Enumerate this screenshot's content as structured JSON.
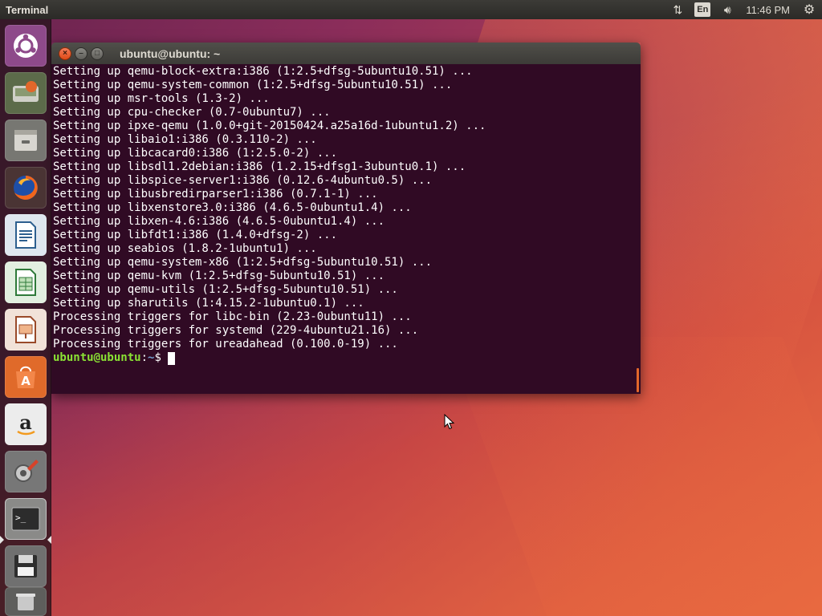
{
  "top_panel": {
    "app_title": "Terminal",
    "network_icon": "network-updown-icon",
    "language": "En",
    "volume_icon": "volume-icon",
    "clock": "11:46 PM",
    "settings_icon": "gear-icon"
  },
  "launcher": {
    "items": [
      {
        "name": "ubuntu-dash-icon",
        "bg": "#7a3a7a"
      },
      {
        "name": "install-ubuntu-icon",
        "bg": "#5a6b48"
      },
      {
        "name": "files-icon",
        "bg": "#6a6a66"
      },
      {
        "name": "firefox-icon",
        "bg": "#5b3a3a"
      },
      {
        "name": "libreoffice-writer-icon",
        "bg": "#2d5f8f"
      },
      {
        "name": "libreoffice-calc-icon",
        "bg": "#2f7a3a"
      },
      {
        "name": "libreoffice-impress-icon",
        "bg": "#9a4a2a"
      },
      {
        "name": "ubuntu-software-icon",
        "bg": "#c8561e"
      },
      {
        "name": "amazon-icon",
        "bg": "#e9e9e9"
      },
      {
        "name": "system-settings-icon",
        "bg": "#6e6e6e"
      },
      {
        "name": "terminal-icon",
        "bg": "#3a3a3a"
      },
      {
        "name": "save-disk-icon",
        "bg": "#6a6a66"
      },
      {
        "name": "trash-icon",
        "bg": "#5a5a58"
      }
    ]
  },
  "terminal": {
    "title": "ubuntu@ubuntu: ~",
    "close_glyph": "×",
    "min_glyph": "–",
    "max_glyph": "□",
    "lines": [
      "Setting up qemu-block-extra:i386 (1:2.5+dfsg-5ubuntu10.51) ...",
      "Setting up qemu-system-common (1:2.5+dfsg-5ubuntu10.51) ...",
      "Setting up msr-tools (1.3-2) ...",
      "Setting up cpu-checker (0.7-0ubuntu7) ...",
      "Setting up ipxe-qemu (1.0.0+git-20150424.a25a16d-1ubuntu1.2) ...",
      "Setting up libaio1:i386 (0.3.110-2) ...",
      "Setting up libcacard0:i386 (1:2.5.0-2) ...",
      "Setting up libsdl1.2debian:i386 (1.2.15+dfsg1-3ubuntu0.1) ...",
      "Setting up libspice-server1:i386 (0.12.6-4ubuntu0.5) ...",
      "Setting up libusbredirparser1:i386 (0.7.1-1) ...",
      "Setting up libxenstore3.0:i386 (4.6.5-0ubuntu1.4) ...",
      "Setting up libxen-4.6:i386 (4.6.5-0ubuntu1.4) ...",
      "Setting up libfdt1:i386 (1.4.0+dfsg-2) ...",
      "Setting up seabios (1.8.2-1ubuntu1) ...",
      "Setting up qemu-system-x86 (1:2.5+dfsg-5ubuntu10.51) ...",
      "Setting up qemu-kvm (1:2.5+dfsg-5ubuntu10.51) ...",
      "Setting up qemu-utils (1:2.5+dfsg-5ubuntu10.51) ...",
      "Setting up sharutils (1:4.15.2-1ubuntu0.1) ...",
      "Processing triggers for libc-bin (2.23-0ubuntu11) ...",
      "Processing triggers for systemd (229-4ubuntu21.16) ...",
      "Processing triggers for ureadahead (0.100.0-19) ..."
    ],
    "prompt_user": "ubuntu@ubuntu",
    "prompt_sep": ":",
    "prompt_path": "~",
    "prompt_symbol": "$"
  }
}
